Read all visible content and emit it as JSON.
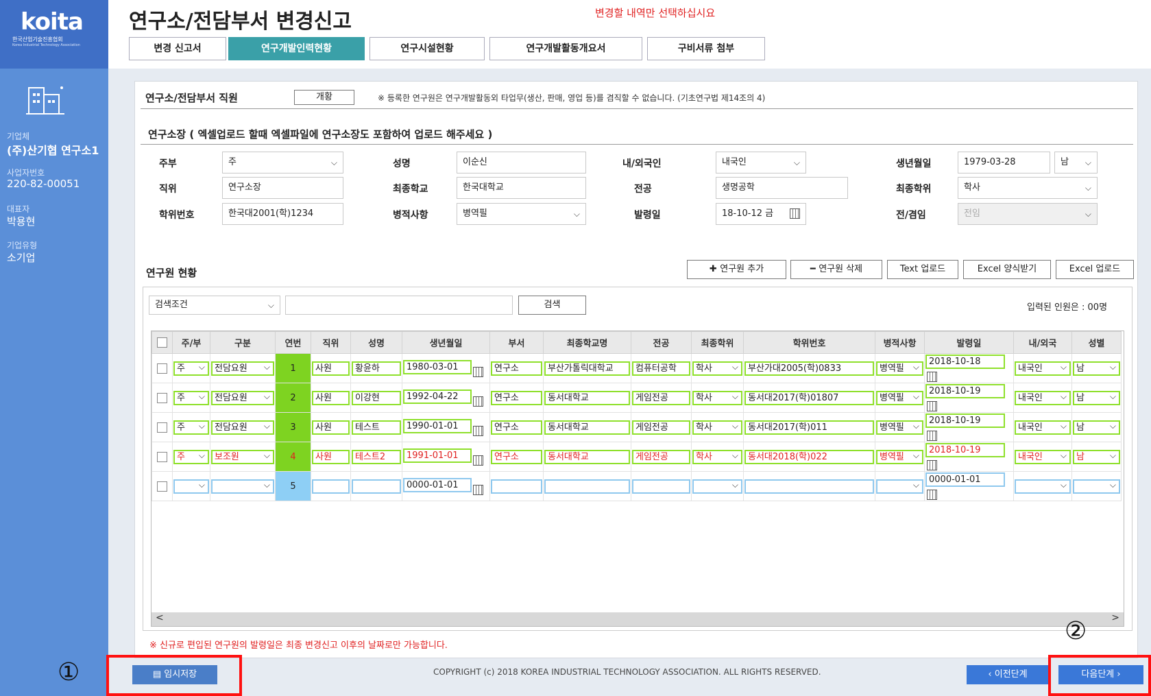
{
  "sidebar": {
    "logo": "koita",
    "logo_sub": "한국산업기술진흥협회",
    "logo_sub2": "Korea Industrial Technology Association",
    "company_label": "기업체",
    "company_value": "(주)산기협 연구소1",
    "bizno_label": "사업자번호",
    "bizno_value": "220-82-00051",
    "ceo_label": "대표자",
    "ceo_value": "박용현",
    "type_label": "기업유형",
    "type_value": "소기업"
  },
  "header": {
    "title": "연구소/전담부서 변경신고",
    "notice": "변경할 내역만 선택하십시요",
    "tabs": [
      {
        "label": "변경 신고서"
      },
      {
        "label": "연구개발인력현황"
      },
      {
        "label": "연구시설현황"
      },
      {
        "label": "연구개발활동개요서"
      },
      {
        "label": "구비서류 첨부"
      }
    ]
  },
  "staff": {
    "title": "연구소/전담부서 직원",
    "overview_button": "개황",
    "note": "※ 등록한 연구원은 연구개발활동외 타업무(생산, 판매, 영업 등)를 겸직할 수 없습니다. (기초연구법 제14조의 4)"
  },
  "director": {
    "title": "연구소장 ( 엑셀업로드 할때 엑셀파일에 연구소장도 포함하여 업로드 해주세요 )",
    "fields": {
      "jubu_label": "주부",
      "jubu_value": "주",
      "name_label": "성명",
      "name_value": "이순신",
      "nation_label": "내/외국인",
      "nation_value": "내국인",
      "birth_label": "생년월일",
      "birth_value": "1979-03-28",
      "gender_value": "남",
      "position_label": "직위",
      "position_value": "연구소장",
      "school_label": "최종학교",
      "school_value": "한국대학교",
      "major_label": "전공",
      "major_value": "생명공학",
      "degree_label": "최종학위",
      "degree_value": "학사",
      "degno_label": "학위번호",
      "degno_value": "한국대2001(학)1234",
      "military_label": "병적사항",
      "military_value": "병역필",
      "appoint_label": "발령일",
      "appoint_value": "18-10-12 금",
      "fulltime_label": "전/겸임",
      "fulltime_value": "전임"
    }
  },
  "researchers": {
    "title": "연구원 현황",
    "buttons": {
      "add": "연구원 추가",
      "delete": "연구원 삭제",
      "text_upload": "Text 업로드",
      "excel_form": "Excel 양식받기",
      "excel_upload": "Excel 업로드"
    },
    "search_condition": "검색조건",
    "search_button": "검색",
    "count_text": "입력된 인원은 : 00명",
    "columns": [
      "주/부",
      "구분",
      "연번",
      "직위",
      "성명",
      "생년월일",
      "부서",
      "최종학교명",
      "전공",
      "최종학위",
      "학위번호",
      "병적사항",
      "발령일",
      "내/외국",
      "성별"
    ],
    "rows": [
      {
        "jubu": "주",
        "type": "전담요원",
        "seq": "1",
        "position": "사원",
        "name": "황윤하",
        "birth": "1980-03-01",
        "dept": "연구소",
        "school": "부산가톨릭대학교",
        "major": "컴퓨터공학",
        "degree": "학사",
        "degno": "부산가대2005(학)0833",
        "military": "병역필",
        "appoint": "2018-10-18",
        "nation": "내국인",
        "gender": "남"
      },
      {
        "jubu": "주",
        "type": "전담요원",
        "seq": "2",
        "position": "사원",
        "name": "이강현",
        "birth": "1992-04-22",
        "dept": "연구소",
        "school": "동서대학교",
        "major": "게임전공",
        "degree": "학사",
        "degno": "동서대2017(학)01807",
        "military": "병역필",
        "appoint": "2018-10-19",
        "nation": "내국인",
        "gender": "남"
      },
      {
        "jubu": "주",
        "type": "전담요원",
        "seq": "3",
        "position": "사원",
        "name": "테스트",
        "birth": "1990-01-01",
        "dept": "연구소",
        "school": "동서대학교",
        "major": "게임전공",
        "degree": "학사",
        "degno": "동서대2017(학)011",
        "military": "병역필",
        "appoint": "2018-10-19",
        "nation": "내국인",
        "gender": "남"
      },
      {
        "jubu": "주",
        "type": "보조원",
        "seq": "4",
        "position": "사원",
        "name": "테스트2",
        "birth": "1991-01-01",
        "dept": "연구소",
        "school": "동서대학교",
        "major": "게임전공",
        "degree": "학사",
        "degno": "동서대2018(학)022",
        "military": "병역필",
        "appoint": "2018-10-19",
        "nation": "내국인",
        "gender": "남"
      },
      {
        "jubu": "",
        "type": "",
        "seq": "5",
        "position": "",
        "name": "",
        "birth": "0000-01-01",
        "dept": "",
        "school": "",
        "major": "",
        "degree": "",
        "degno": "",
        "military": "",
        "appoint": "0000-01-01",
        "nation": "",
        "gender": ""
      }
    ]
  },
  "footer": {
    "note": "※ 신규로 편입된 연구원의 발령일은 최종 변경신고 이후의 날짜로만 가능합니다.",
    "save_button": "임시저장",
    "copyright": "COPYRIGHT (c) 2018 KOREA INDUSTRIAL TECHNOLOGY ASSOCIATION. ALL RIGHTS RESERVED.",
    "prev_button": "이전단계",
    "next_button": "다음단계",
    "marker1": "①",
    "marker2": "②"
  }
}
